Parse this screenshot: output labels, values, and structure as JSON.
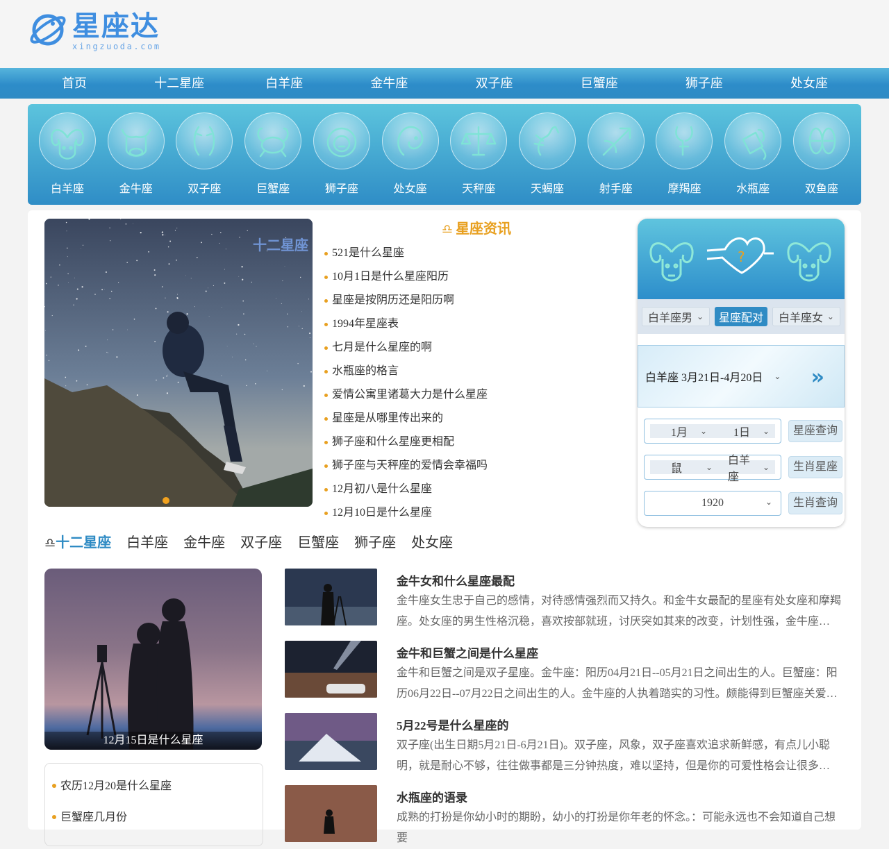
{
  "brand": {
    "name": "星座达",
    "domain": "xingzuoda.com",
    "color": "#3f8ee0"
  },
  "nav": [
    "首页",
    "十二星座",
    "白羊座",
    "金牛座",
    "双子座",
    "巨蟹座",
    "狮子座",
    "处女座"
  ],
  "zodiacs": [
    {
      "label": "白羊座",
      "icon": "aries-icon"
    },
    {
      "label": "金牛座",
      "icon": "taurus-icon"
    },
    {
      "label": "双子座",
      "icon": "gemini-icon"
    },
    {
      "label": "巨蟹座",
      "icon": "cancer-icon"
    },
    {
      "label": "狮子座",
      "icon": "leo-icon"
    },
    {
      "label": "处女座",
      "icon": "virgo-icon"
    },
    {
      "label": "天秤座",
      "icon": "libra-icon"
    },
    {
      "label": "天蝎座",
      "icon": "scorpio-icon"
    },
    {
      "label": "射手座",
      "icon": "sagittarius-icon"
    },
    {
      "label": "摩羯座",
      "icon": "capricorn-icon"
    },
    {
      "label": "水瓶座",
      "icon": "aquarius-icon"
    },
    {
      "label": "双鱼座",
      "icon": "pisces-icon"
    }
  ],
  "hero": {
    "watermark": "十二星座"
  },
  "news": {
    "title": "星座资讯",
    "items": [
      "521是什么星座",
      "10月1日是什么星座阳历",
      "星座是按阴历还是阳历啊",
      "1994年星座表",
      "七月是什么星座的啊",
      "水瓶座的格言",
      "爱情公寓里诸葛大力是什么星座",
      "星座是从哪里传出来的",
      "狮子座和什么星座更相配",
      "狮子座与天秤座的爱情会幸福吗",
      "12月初八是什么星座",
      "12月10日是什么星座"
    ]
  },
  "match": {
    "male": "白羊座男",
    "pair_button": "星座配对",
    "female": "白羊座女",
    "range": "白羊座 3月21日-4月20日",
    "month": "1月",
    "day": "1日",
    "star_query": "星座查询",
    "animal": "鼠",
    "sign": "白羊座",
    "animal_query": "生肖星座",
    "year": "1920",
    "year_query": "生肖查询"
  },
  "tabs": [
    "十二星座",
    "白羊座",
    "金牛座",
    "双子座",
    "巨蟹座",
    "狮子座",
    "处女座"
  ],
  "feature": {
    "caption": "12月15日是什么星座"
  },
  "mini_list": [
    "农历12月20是什么星座",
    "巨蟹座几月份"
  ],
  "articles": [
    {
      "title": "金牛女和什么星座最配",
      "desc": "金牛座女生忠于自己的感情，对待感情强烈而又持久。和金牛女最配的星座有处女座和摩羯座。处女座的男生性格沉稳，喜欢按部就班，讨厌突如其来的改变，计划性强，金牛座女生…"
    },
    {
      "title": "金牛和巨蟹之间是什么星座",
      "desc": "金牛和巨蟹之间是双子星座。金牛座：阳历04月21日--05月21日之间出生的人。巨蟹座：阳历06月22日--07月22日之间出生的人。金牛座的人执着踏实的习性。颇能得到巨蟹座关爱的眼神，…"
    },
    {
      "title": "5月22号是什么星座的",
      "desc": "双子座(出生日期5月21日-6月21日)。双子座，风象，双子座喜欢追求新鲜感，有点儿小聪明，就是耐心不够，往往做事都是三分钟热度，难以坚持，但是你的可爱性格会让很多人都喜欢…"
    },
    {
      "title": "水瓶座的语录",
      "desc": "成熟的打扮是你幼小时的期盼，幼小的打扮是你年老的怀念。：可能永远也不会知道自己想要"
    }
  ]
}
